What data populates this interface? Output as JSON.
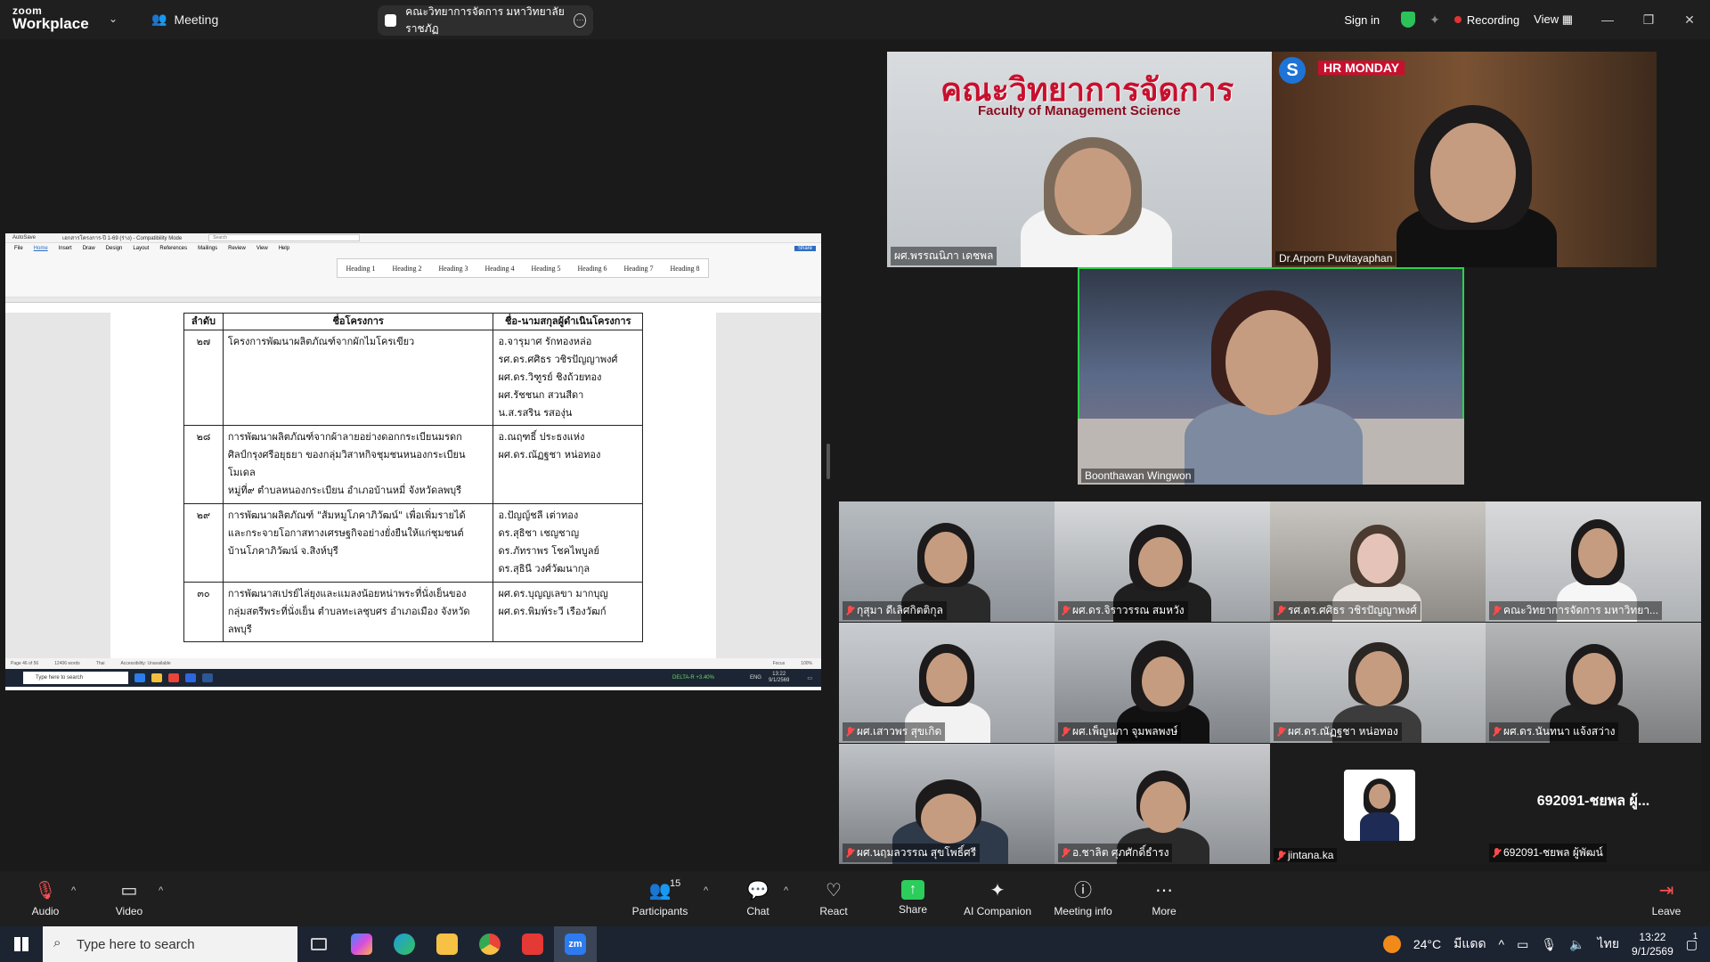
{
  "zoom": {
    "logo_top": "zoom",
    "logo_bottom": "Workplace",
    "meeting_label": "Meeting",
    "tab_title": "คณะวิทยาการจัดการ มหาวิทยาลัยราชภัฏ",
    "sign_in": "Sign in",
    "recording": "Recording",
    "view": "View"
  },
  "word": {
    "autosave": "AutoSave",
    "filename": "เอกสารโครงการ-ปี 1-69 (ร่าง) - Compatibility Mode",
    "search_placeholder": "Search",
    "menu": [
      "File",
      "Home",
      "Insert",
      "Draw",
      "Design",
      "Layout",
      "References",
      "Mailings",
      "Review",
      "View",
      "Help"
    ],
    "share": "Share",
    "styles": [
      "Heading 1",
      "Heading 2",
      "Heading 3",
      "Heading 4",
      "Heading 5",
      "Heading 6",
      "Heading 7",
      "Heading 8"
    ],
    "status_page": "Page 46 of 56",
    "status_words": "12406 words",
    "status_lang": "Thai",
    "status_access": "Accessibility: Unavailable",
    "status_focus": "Focus",
    "zoom_pct": "100%",
    "task_search": "Type here to search",
    "task_ticker": "DELTA-R +3.40%",
    "task_lang": "ENG",
    "task_time": "13:22",
    "task_date": "9/1/2569",
    "table_headers": [
      "ลำดับ",
      "ชื่อโครงการ",
      "ชื่อ-นามสกุลผู้ดำเนินโครงการ"
    ],
    "rows": [
      {
        "no": "๒๗",
        "project": [
          "โครงการพัฒนาผลิตภัณฑ์จากผักไมโครเขียว"
        ],
        "people": [
          "อ.จารุมาศ รักทองหล่อ",
          "รศ.ดร.ศศิธร วชิรปัญญาพงศ์",
          "ผศ.ดร.วิฑูรย์ ชิงถ้วยทอง",
          "ผศ.รัชชนก สวนสีดา",
          "น.ส.รสริน รสองุ่น"
        ]
      },
      {
        "no": "๒๘",
        "project": [
          "การพัฒนาผลิตภัณฑ์จากผ้าลายอย่างดอกกระเบียนมรดก",
          "ศิลป์กรุงศรีอยุธยา ของกลุ่มวิสาหกิจชุมชนหนองกระเบียน",
          "โมเดล",
          "หมู่ที่๙ ตำบลหนองกระเบียน อำเภอบ้านหมี่ จังหวัดลพบุรี"
        ],
        "people": [
          "อ.ณฤฑธิ์ ประธงแห่ง",
          "ผศ.ดร.ณัฏฐชา หน่อทอง"
        ]
      },
      {
        "no": "๒๙",
        "project": [
          "การพัฒนาผลิตภัณฑ์ \"ส้มหมูโภคาภิวัฒน์\" เพื่อเพิ่มรายได้",
          "และกระจายโอกาสทางเศรษฐกิจอย่างยั่งยืนให้แก่ชุมชนต์",
          "บ้านโภคาภิวัฒน์ จ.สิงห์บุรี"
        ],
        "people": [
          "อ.ปัญญ์ชลี เต่าทอง",
          "ดร.สุธิชา เชญชาญ",
          "ดร.ภัทราพร โชคไพบูลย์",
          "ดร.สุธินี วงศ์วัฒนากุล"
        ]
      },
      {
        "no": "๓๐",
        "project": [
          "การพัฒนาสเปรย์ไล่ยุงและแมลงน้อยหน่าพระที่นั่งเย็นของ",
          "กลุ่มสตรีพระที่นั่งเย็น ตำบลทะเลชุบศร อำเภอเมือง จังหวัด",
          "ลพบุรี"
        ],
        "people": [
          "ผศ.ดร.บุญญเลขา มากบุญ",
          "ผศ.ดร.พิมพ์ระวี เรืองวัฒก์"
        ]
      }
    ]
  },
  "participants": {
    "top": [
      {
        "name": "ผศ.พรรณนิภา เดชพล",
        "banner": "คณะวิทยาการจัดการ",
        "banner_sub": "Faculty of Management Science"
      },
      {
        "name": "Dr.Arporn Puvitayaphan",
        "brand": "HR MONDAY"
      },
      {
        "name": "Boonthawan Wingwon"
      }
    ],
    "grid": [
      "กุสุมา ดีเลิศกิตติกุล",
      "ผศ.ดร.จิราวรรณ สมหวัง",
      "รศ.ดร.ศศิธร วชิรปัญญาพงศ์",
      "คณะวิทยาการจัดการ มหาวิทยา...",
      "ผศ.เสาวพร สุขเกิด",
      "ผศ.เพ็ญนภา จุมพลพงษ์",
      "ผศ.ดร.ณัฏฐชา หน่อทอง",
      "ผศ.ดร.นันทนา แจ้งสว่าง",
      "ผศ.นฤมลวรรณ สุขโพธิ์ศรี",
      "อ.ชาลิต ศุภศักดิ์ธำรง",
      "jintana.ka",
      "692091-ชยพล ผู้พัฒน์"
    ],
    "big_name": "692091-ชยพล ผู้..."
  },
  "toolbar": {
    "audio": "Audio",
    "video": "Video",
    "participants": "Participants",
    "participants_count": "15",
    "chat": "Chat",
    "react": "React",
    "share": "Share",
    "ai": "AI Companion",
    "info": "Meeting info",
    "more": "More",
    "leave": "Leave"
  },
  "taskbar": {
    "search": "Type here to search",
    "temp": "24°C",
    "weather": "มีแดด",
    "lang": "ไทย",
    "time": "13:22",
    "date": "9/1/2569",
    "notif": "1"
  }
}
